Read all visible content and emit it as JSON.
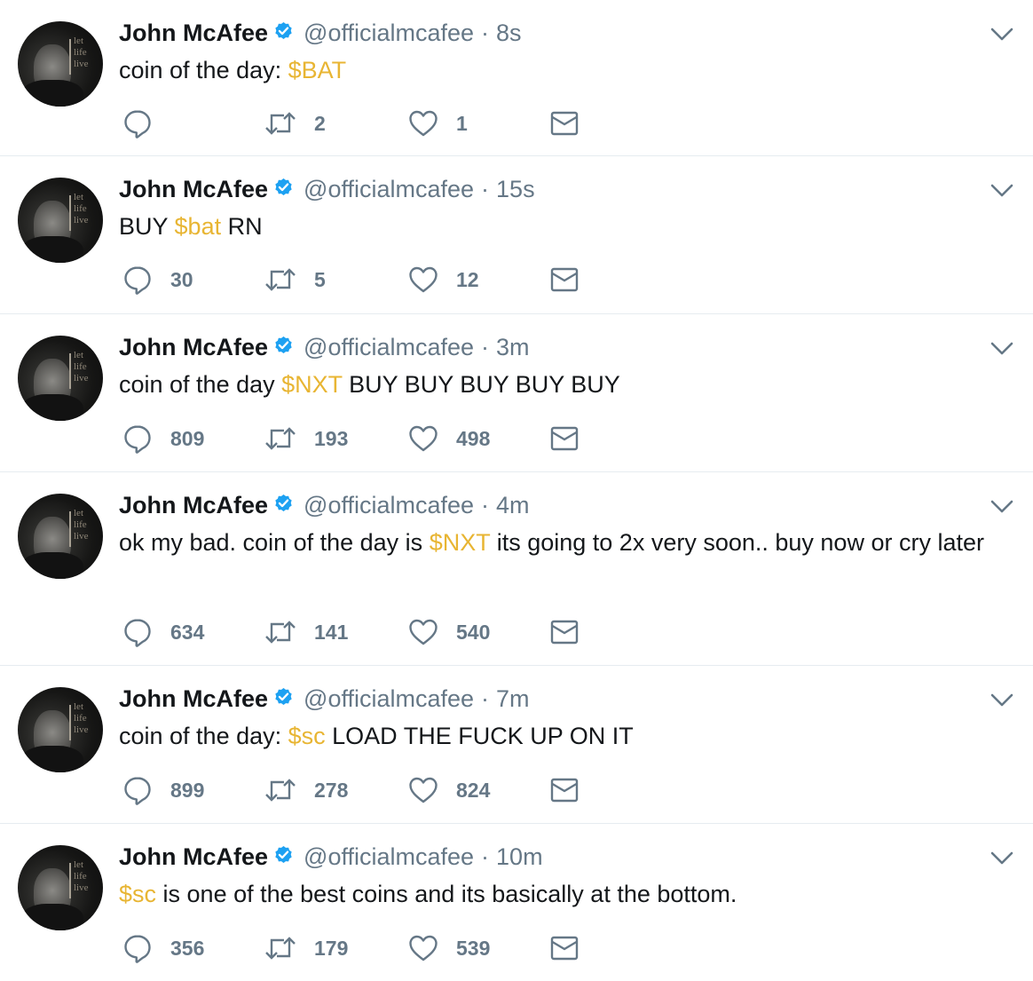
{
  "colors": {
    "cashtag": "#e8b533",
    "meta": "#657786",
    "verified": "#1da1f2",
    "divider": "#e6ecf0"
  },
  "icons": {
    "reply": "speech-bubble-icon",
    "retweet": "retweet-arrows-icon",
    "like": "heart-outline-icon",
    "dm": "envelope-icon",
    "more": "chevron-down-icon",
    "verified": "verified-badge-icon"
  },
  "avatar_words": [
    "let",
    "life",
    "live"
  ],
  "tweets": [
    {
      "name": "John McAfee",
      "handle": "@officialmcafee",
      "sep": "·",
      "time": "8s",
      "segments": [
        {
          "t": "coin of the day: "
        },
        {
          "t": "$BAT",
          "tag": true
        }
      ],
      "replies": "",
      "retweets": "2",
      "likes": "1"
    },
    {
      "name": "John McAfee",
      "handle": "@officialmcafee",
      "sep": "·",
      "time": "15s",
      "segments": [
        {
          "t": "BUY "
        },
        {
          "t": "$bat",
          "tag": true
        },
        {
          "t": " RN"
        }
      ],
      "replies": "30",
      "retweets": "5",
      "likes": "12"
    },
    {
      "name": "John McAfee",
      "handle": "@officialmcafee",
      "sep": "·",
      "time": "3m",
      "segments": [
        {
          "t": "coin of the day "
        },
        {
          "t": "$NXT",
          "tag": true
        },
        {
          "t": " BUY BUY BUY BUY BUY"
        }
      ],
      "replies": "809",
      "retweets": "193",
      "likes": "498"
    },
    {
      "name": "John McAfee",
      "handle": "@officialmcafee",
      "sep": "·",
      "time": "4m",
      "segments": [
        {
          "t": "ok my bad. coin of the day is "
        },
        {
          "t": "$NXT",
          "tag": true
        },
        {
          "t": " its going to 2x very soon.. buy now or cry later"
        }
      ],
      "replies": "634",
      "retweets": "141",
      "likes": "540"
    },
    {
      "name": "John McAfee",
      "handle": "@officialmcafee",
      "sep": "·",
      "time": "7m",
      "segments": [
        {
          "t": "coin of the day: "
        },
        {
          "t": "$sc",
          "tag": true
        },
        {
          "t": " LOAD THE FUCK UP ON IT"
        }
      ],
      "replies": "899",
      "retweets": "278",
      "likes": "824"
    },
    {
      "name": "John McAfee",
      "handle": "@officialmcafee",
      "sep": "·",
      "time": "10m",
      "segments": [
        {
          "t": "$sc",
          "tag": true
        },
        {
          "t": " is one of the best coins and its basically at the bottom."
        }
      ],
      "replies": "356",
      "retweets": "179",
      "likes": "539"
    }
  ]
}
